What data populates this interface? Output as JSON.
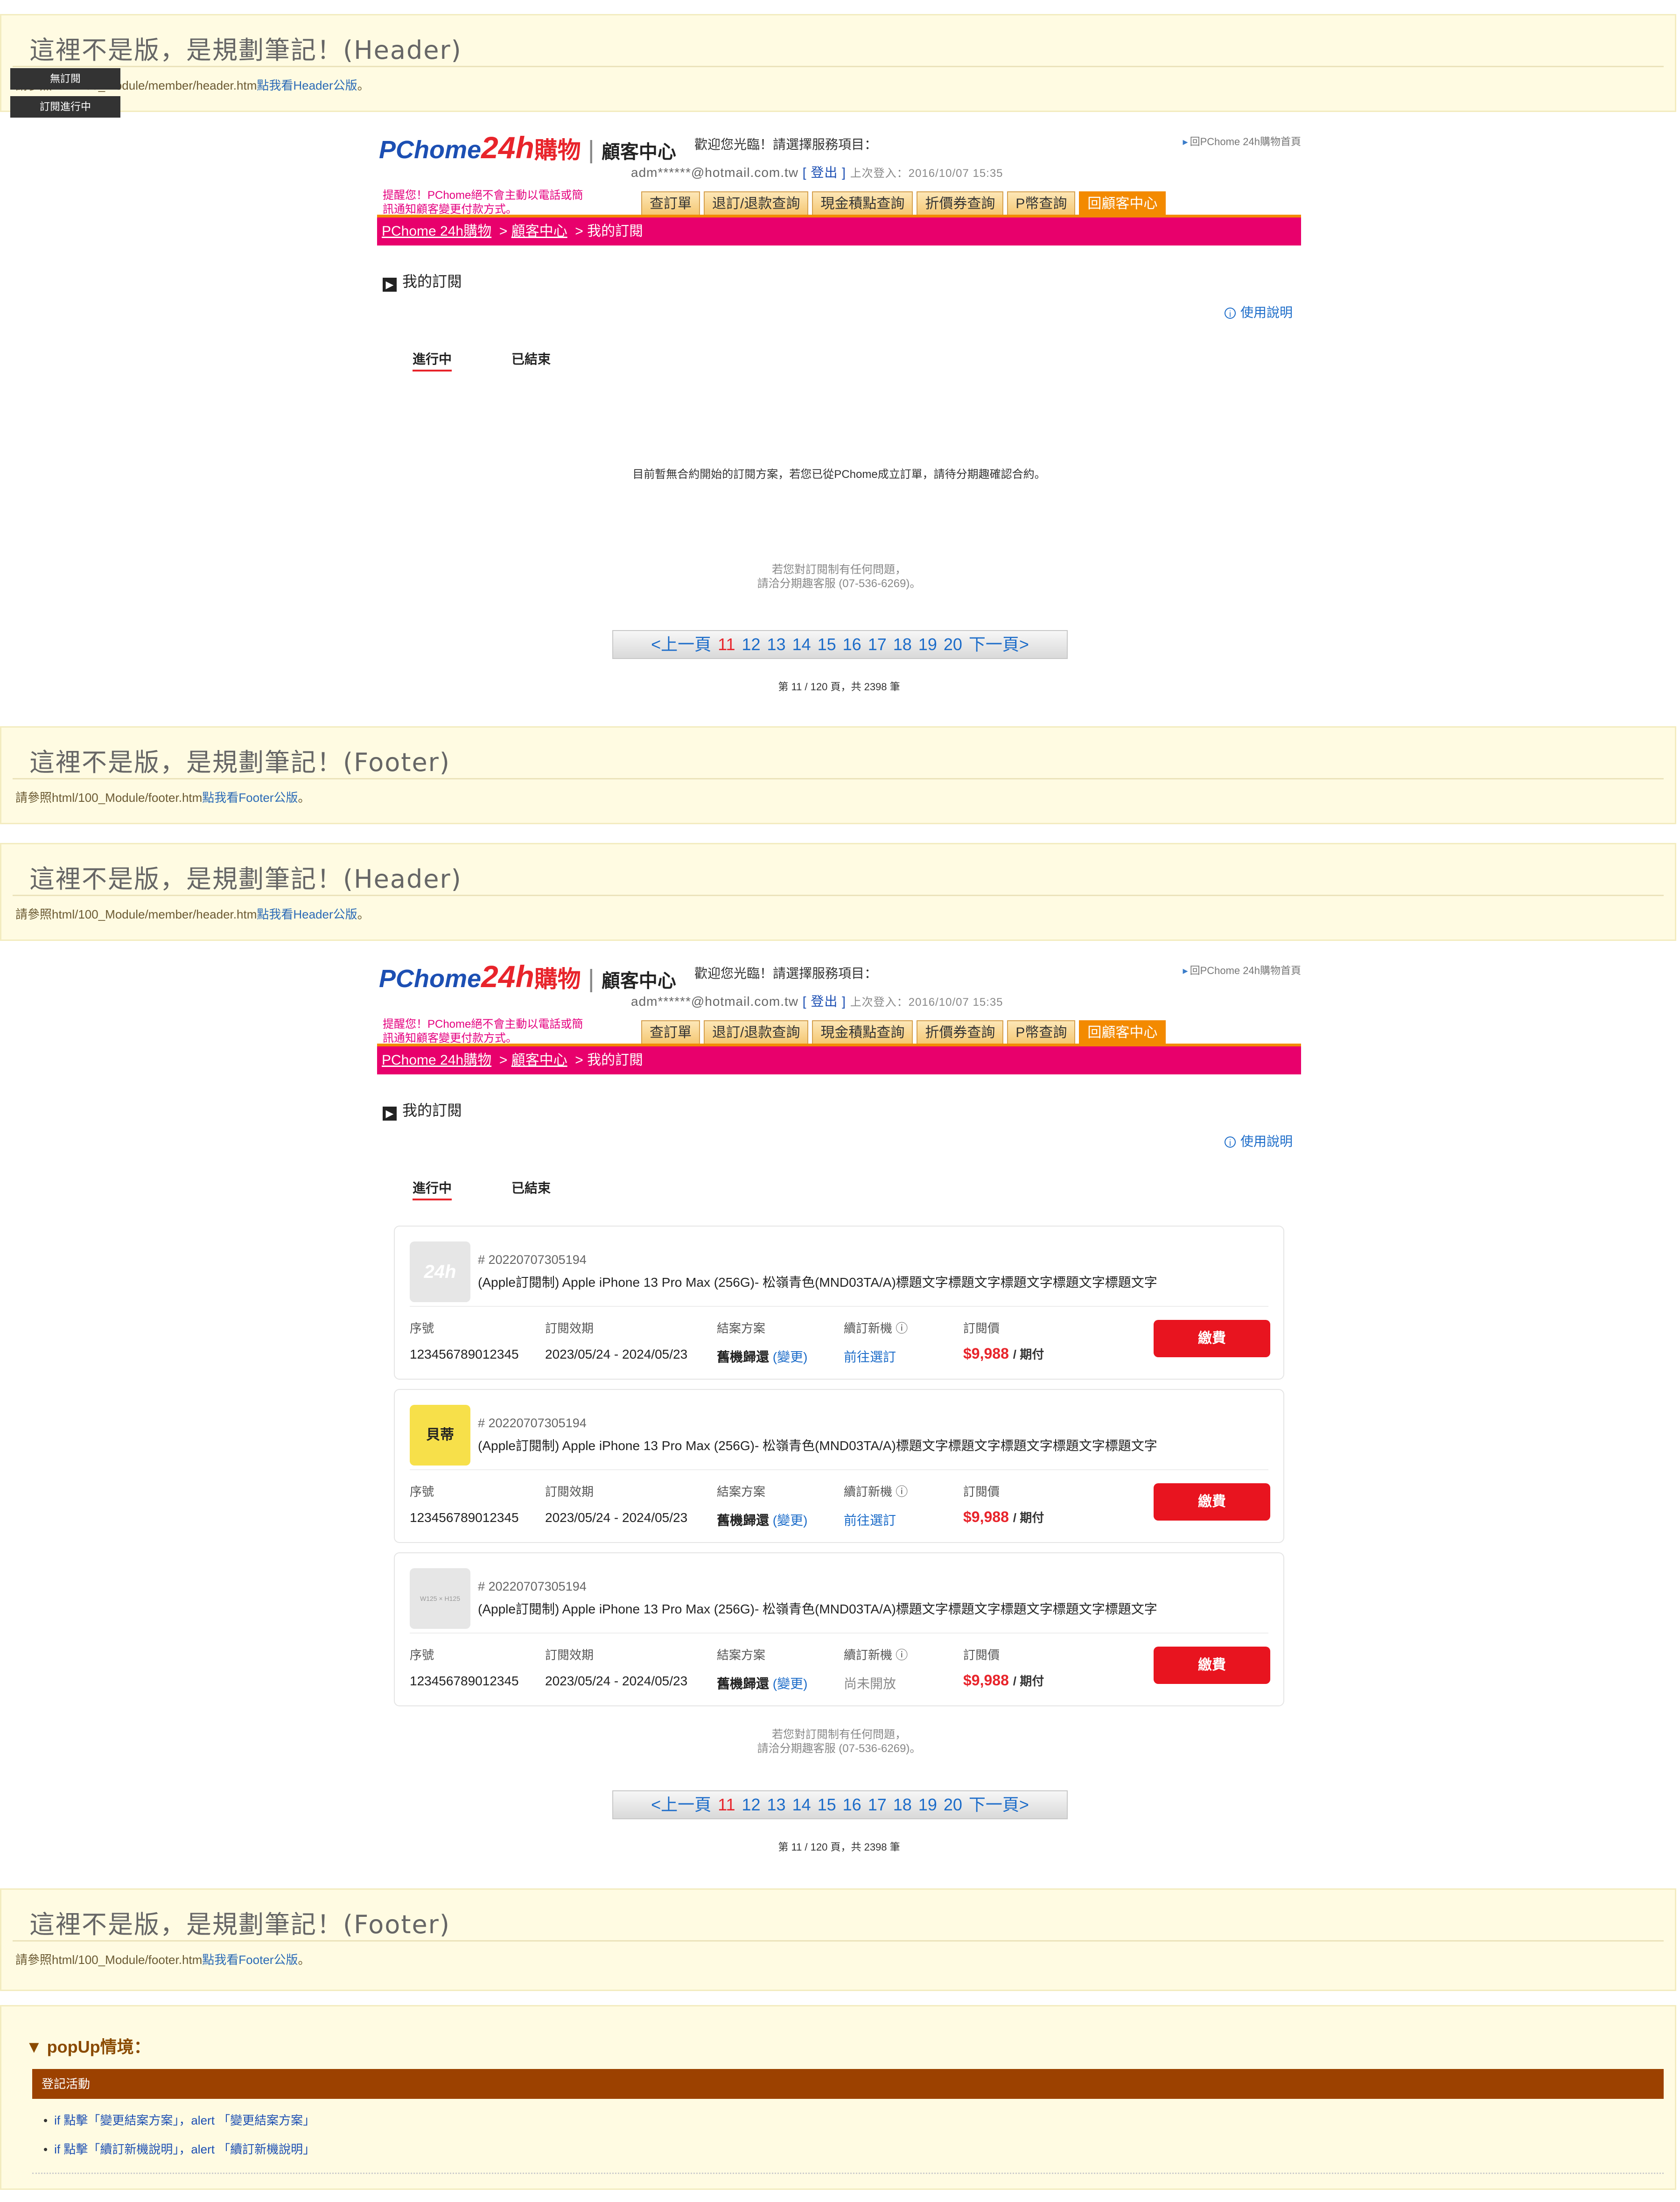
{
  "notes": {
    "header_title": "這裡不是版，是規劃筆記！(Header)",
    "footer_title": "這裡不是版，是規劃筆記！(Footer)",
    "header_path": "請參照html/100_Module/member/header.htm",
    "header_link": "點我看Header公版",
    "footer_path": "請參照html/100_Module/footer.htm",
    "footer_link": "點我看Footer公版",
    "period": "。"
  },
  "toggles": [
    "無訂閱",
    "訂閱進行中"
  ],
  "site": {
    "logo_pc": "PChome",
    "logo_24": "24h",
    "logo_gw": "購物",
    "logo_sep": "|",
    "logo_cc": "顧客中心",
    "welcome": "歡迎您光臨！請選擇服務項目：",
    "home_link": "回PChome 24h購物首頁",
    "account": "adm******@hotmail.com.tw",
    "logout": "[ 登出 ]",
    "last_login": "上次登入：2016/10/07 15:35",
    "warning": "提醒您！PChome絕不會主動以電話或簡訊通知顧客變更付款方式。",
    "tabs": [
      "查訂單",
      "退訂/退款查詢",
      "現金積點查詢",
      "折價券查詢",
      "P幣查詢",
      "回顧客中心"
    ],
    "breadcrumb": [
      "PChome 24h購物",
      "顧客中心",
      "我的訂閱"
    ],
    "section_title": "我的訂閱",
    "help": "使用說明",
    "subtabs": [
      "進行中",
      "已結束"
    ],
    "empty_message": "目前暫無合約開始的訂閱方案，若您已從PChome成立訂單，請待分期趣確認合約。",
    "contact_line1": "若您對訂閱制有任何問題，",
    "contact_line2": "請洽分期趣客服 (07-536-6269)。",
    "pager": [
      "<上一頁",
      "11",
      "12",
      "13",
      "14",
      "15",
      "16",
      "17",
      "18",
      "19",
      "20",
      "下一頁>"
    ],
    "pager_current": "11",
    "page_info": "第 11 / 120 頁，共 2398 筆"
  },
  "orders": [
    {
      "number": "# 20220707305194",
      "name": "(Apple訂閱制) Apple iPhone 13 Pro Max (256G)- 松嶺青色(MND03TA/A)標題文字標題文字標題文字標題文字標題文字",
      "labels": [
        "序號",
        "訂閱效期",
        "結案方案",
        "續訂新機",
        "訂閱價"
      ],
      "serial": "123456789012345",
      "period": "2023/05/24 - 2024/05/23",
      "plan": "舊機歸還",
      "plan_change": "(變更)",
      "renew": "前往選訂",
      "price": "$9,988",
      "price_unit": "/ 期付",
      "pay": "繳費",
      "thumb": "24h"
    },
    {
      "number": "# 20220707305194",
      "name": "(Apple訂閱制) Apple iPhone 13 Pro Max (256G)- 松嶺青色(MND03TA/A)標題文字標題文字標題文字標題文字標題文字",
      "labels": [
        "序號",
        "訂閱效期",
        "結案方案",
        "續訂新機",
        "訂閱價"
      ],
      "serial": "123456789012345",
      "period": "2023/05/24 - 2024/05/23",
      "plan": "舊機歸還",
      "plan_change": "(變更)",
      "renew": "前往選訂",
      "price": "$9,988",
      "price_unit": "/ 期付",
      "pay": "繳費",
      "thumb": "貝蒂"
    },
    {
      "number": "# 20220707305194",
      "name": "(Apple訂閱制) Apple iPhone 13 Pro Max (256G)- 松嶺青色(MND03TA/A)標題文字標題文字標題文字標題文字標題文字",
      "labels": [
        "序號",
        "訂閱效期",
        "結案方案",
        "續訂新機",
        "訂閱價"
      ],
      "serial": "123456789012345",
      "period": "2023/05/24 - 2024/05/23",
      "plan": "舊機歸還",
      "plan_change": "(變更)",
      "renew": "尚未開放",
      "price": "$9,988",
      "price_unit": "/ 期付",
      "pay": "繳費",
      "thumb": "W125 × H125"
    }
  ],
  "popup": {
    "title": "▼ popUp情境：",
    "bar": "登記活動",
    "items": [
      "if 點擊「變更結案方案」，alert 「變更結案方案」",
      "if 點擊「續訂新機說明」，alert 「續訂新機說明」"
    ]
  }
}
